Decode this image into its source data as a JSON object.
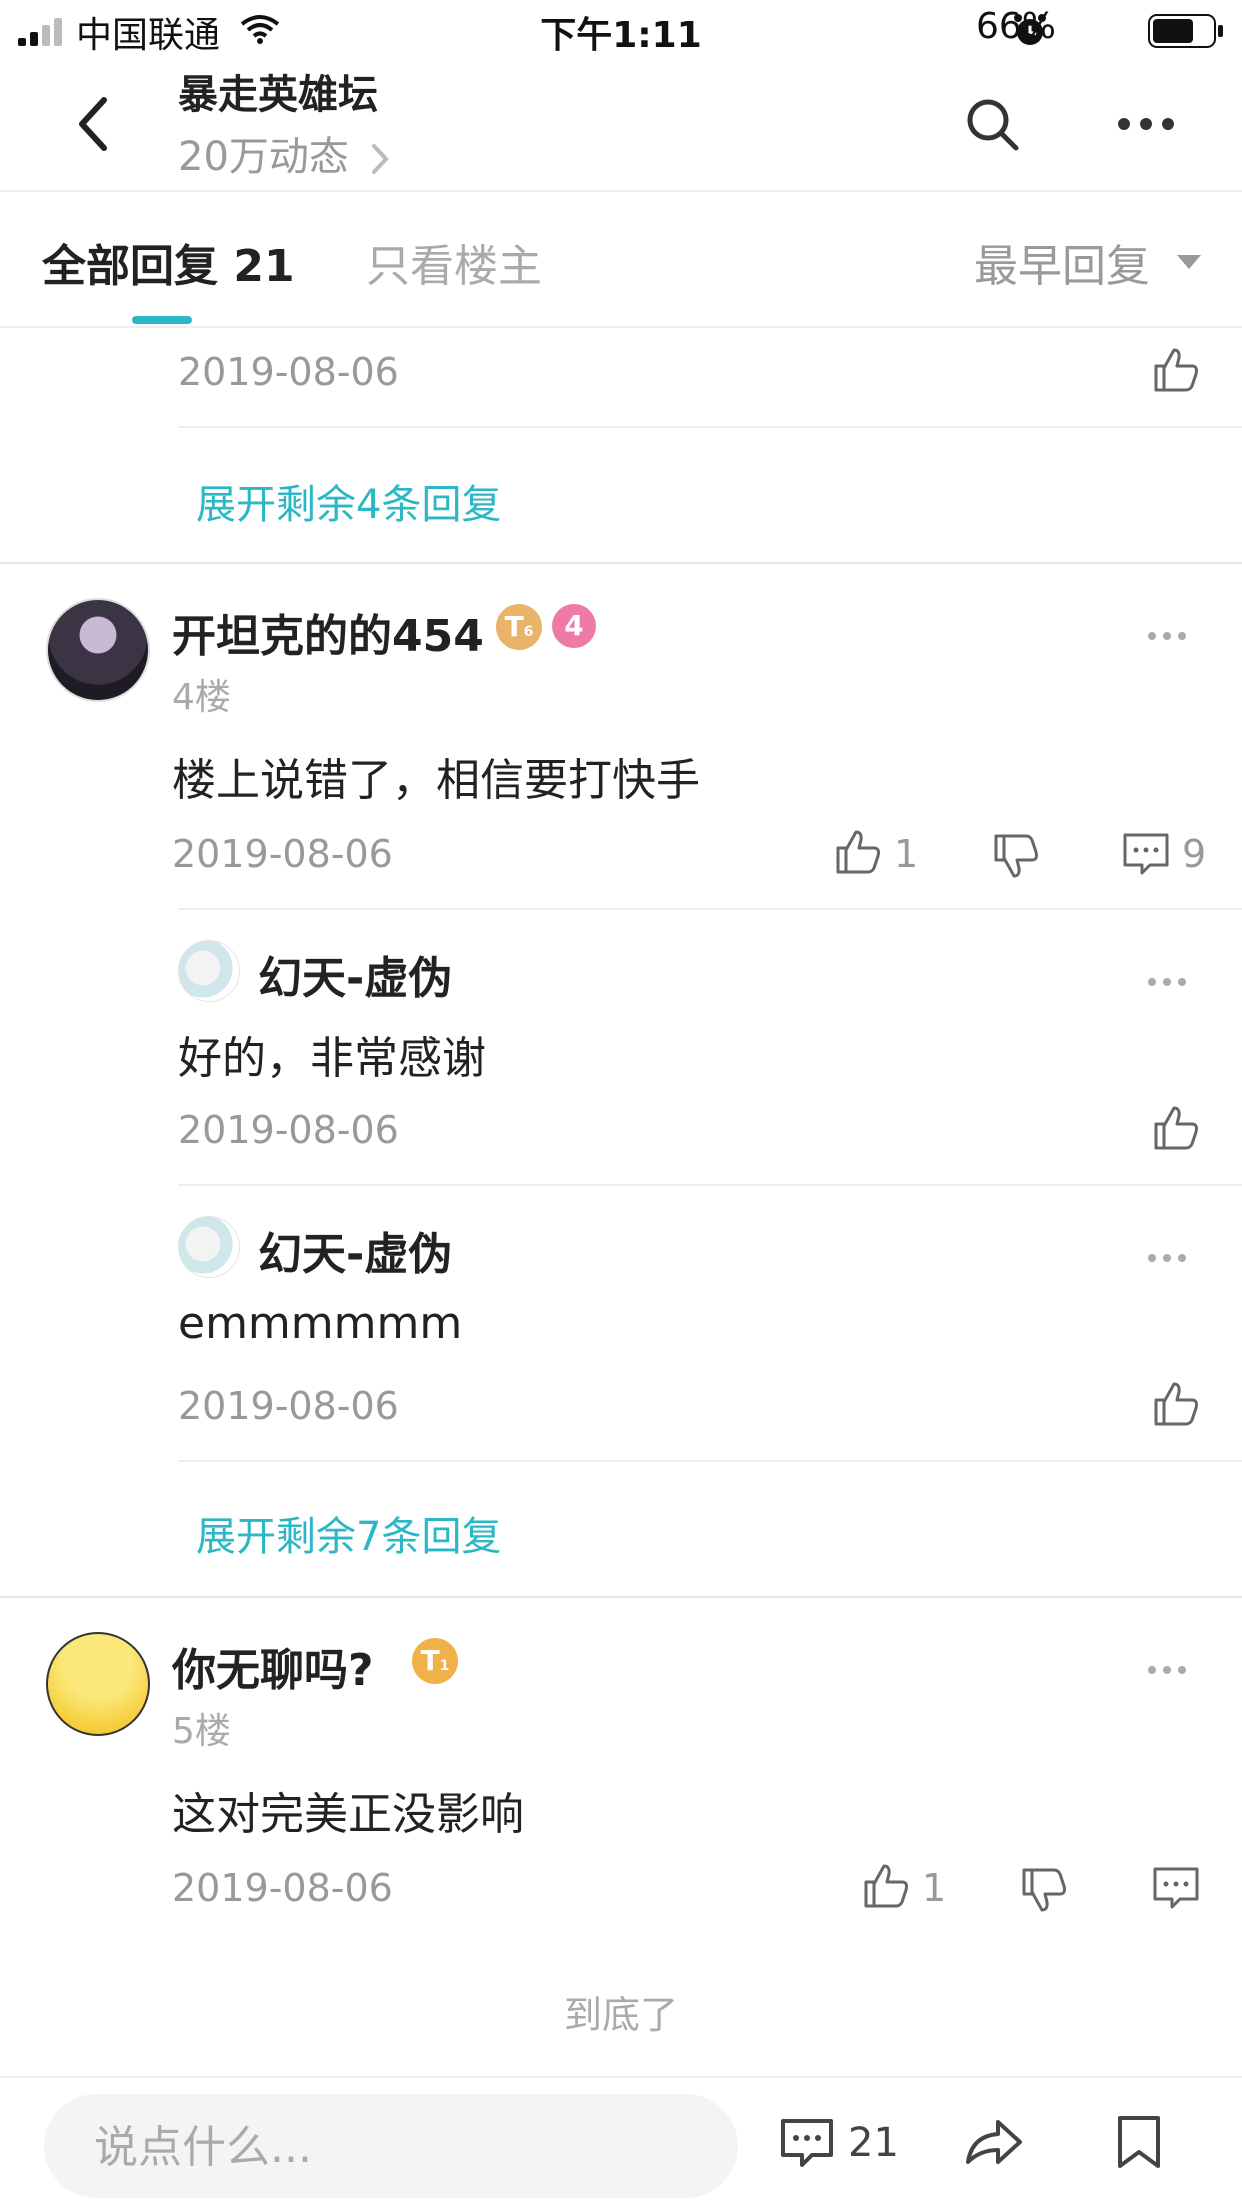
{
  "status_bar": {
    "carrier": "中国联通",
    "time": "下午1:11",
    "battery": "66%"
  },
  "header": {
    "title": "暴走英雄坛",
    "subtitle": "20万动态"
  },
  "tabs": {
    "all_label": "全部回复",
    "all_count": "21",
    "owner_label": "只看楼主",
    "sort_label": "最早回复"
  },
  "prev_tail": {
    "date": "2019-08-06",
    "expand_text": "展开剩余4条回复"
  },
  "posts": [
    {
      "username": "开坦克的的454",
      "level_badge": "T",
      "level_sub": "6",
      "rank_badge": "4",
      "floor": "4楼",
      "content": "楼上说错了，相信要打快手",
      "date": "2019-08-06",
      "likes": "1",
      "comments": "9",
      "replies": [
        {
          "username": "幻天-虚伪",
          "content": "好的，非常感谢",
          "date": "2019-08-06"
        },
        {
          "username": "幻天-虚伪",
          "content": "emmmmmm",
          "date": "2019-08-06"
        }
      ],
      "expand_text": "展开剩余7条回复"
    },
    {
      "username": "你无聊吗?",
      "level_badge": "T",
      "level_sub": "1",
      "floor": "5楼",
      "content": "这对完美正没影响",
      "date": "2019-08-06",
      "likes": "1"
    }
  ],
  "end_text": "到底了",
  "bottom_bar": {
    "placeholder": "说点什么...",
    "comment_count": "21"
  },
  "colors": {
    "accent": "#2bb7c5",
    "text": "#222222",
    "muted": "#999999",
    "badge_gold": "#f0b04a",
    "badge_pink": "#f07aa6"
  }
}
